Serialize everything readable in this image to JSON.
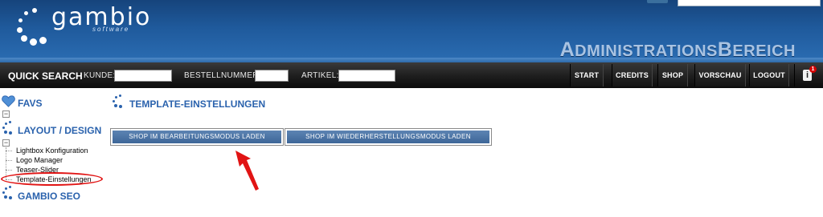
{
  "header": {
    "logo_text": "gambio",
    "logo_sub": "software",
    "admin_title_part1": "ADMINISTRATIONS",
    "admin_title_part2": "BEREICH"
  },
  "navbar": {
    "quick_search_label": "QUICK SEARCH",
    "fields": [
      {
        "label": "KUNDE:",
        "value": ""
      },
      {
        "label": "BESTELLNUMMER:",
        "value": ""
      },
      {
        "label": "ARTIKEL:",
        "value": ""
      }
    ],
    "buttons": [
      "START",
      "CREDITS",
      "SHOP",
      "VORSCHAU",
      "LOGOUT"
    ],
    "info_badge": "1"
  },
  "sidebar": {
    "favs": "FAVS",
    "layout_design": "LAYOUT / DESIGN",
    "toggle_symbol": "−",
    "items": [
      "Lightbox Konfiguration",
      "Logo Manager",
      "Teaser-Slider",
      "Template-Einstellungen"
    ],
    "gambio_seo": "GAMBIO SEO"
  },
  "main": {
    "title": "TEMPLATE-EINSTELLUNGEN",
    "btn_edit_mode": "SHOP IM BEARBEITUNGSMODUS LADEN",
    "btn_restore_mode": "SHOP IM WIEDERHERSTELLUNGSMODUS LADEN"
  },
  "colors": {
    "brand_blue": "#2a62ad",
    "annotation_red": "#e11414"
  },
  "icons": {
    "favs": "heart-icon",
    "sections": "dots-icon",
    "info": "info-icon"
  }
}
